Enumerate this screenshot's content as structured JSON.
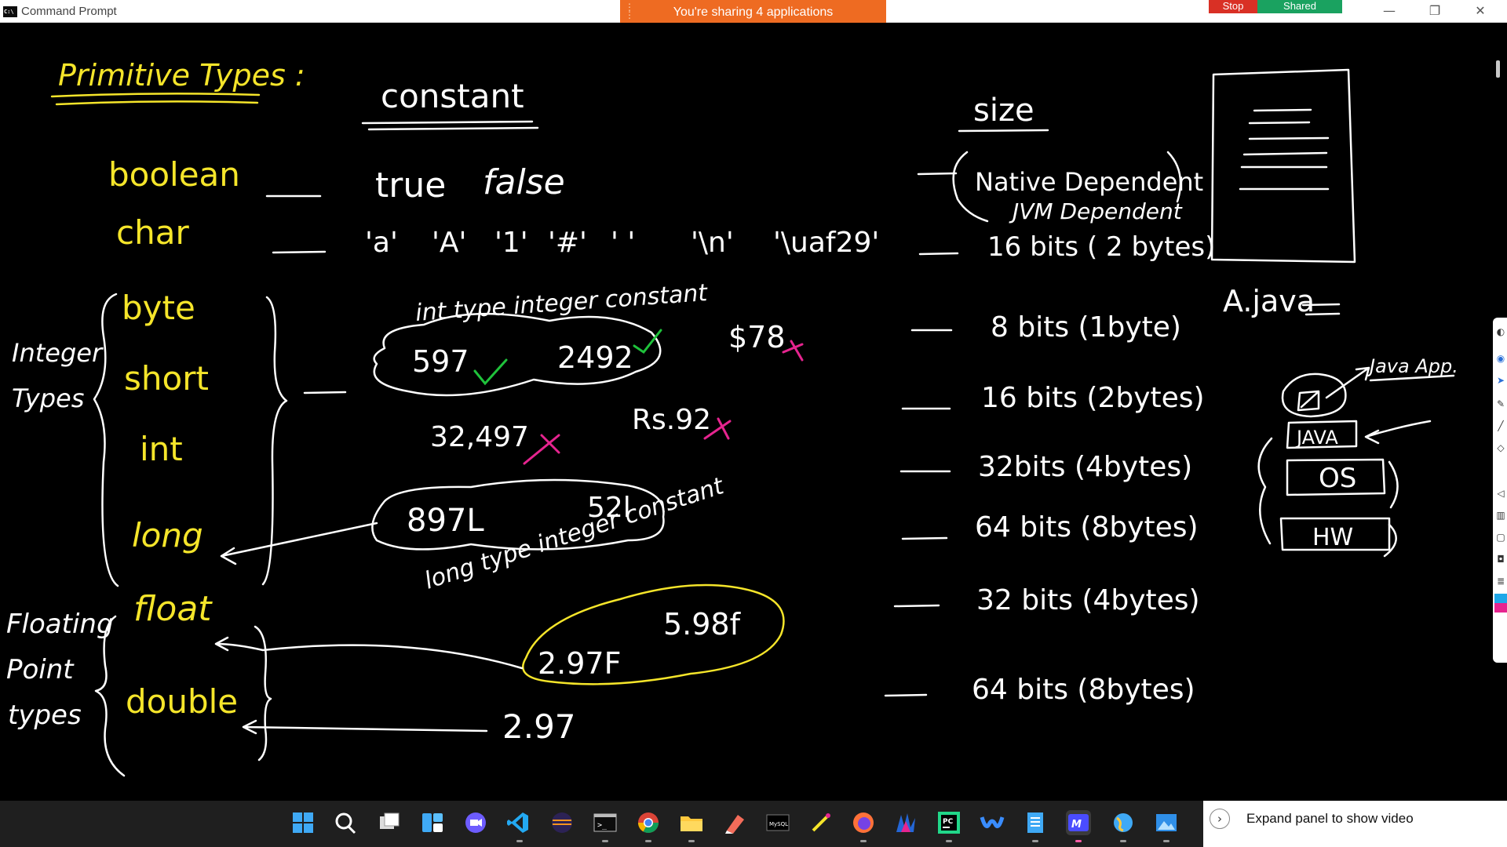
{
  "window": {
    "title": "Command Prompt",
    "icon": "C:\\"
  },
  "share_banner": {
    "text": "You're sharing 4 applications",
    "stop": "Stop",
    "shared": "Shared"
  },
  "window_controls": {
    "minimize": "—",
    "maximize": "❐",
    "close": "✕"
  },
  "board": {
    "title": "Primitive Types :",
    "col_constant": "constant",
    "col_size": "size",
    "rows": {
      "boolean": "boolean",
      "char": "char",
      "byte": "byte",
      "short": "short",
      "int": "int",
      "long": "long",
      "float": "float",
      "double": "double"
    },
    "groups": {
      "integer_1": "Integer",
      "integer_2": "Types",
      "floating_1": "Floating",
      "floating_2": "Point",
      "floating_3": "types"
    },
    "constants": {
      "true": "true",
      "false": "false",
      "char_values": [
        "'a'",
        "'A'",
        "'1'",
        "'#'",
        "' '",
        "'\\n'",
        "'\\uaf29'"
      ],
      "int_caption": "int type integer constant",
      "int_ok_1": "597",
      "int_ok_2": "2492",
      "bad_dollar": "$78",
      "bad_comma": "32,497",
      "bad_rs": "Rs.92",
      "long_1": "897L",
      "long_2": "52l",
      "long_caption": "long type integer constant",
      "float_1": "2.97F",
      "float_2": "5.98f",
      "double_1": "2.97"
    },
    "sizes": {
      "boolean_1": "Native Dependent",
      "boolean_2": "JVM Dependent",
      "char": "16 bits ( 2 bytes)",
      "byte": "8 bits (1byte)",
      "short": "16 bits (2bytes)",
      "int": "32bits (4bytes)",
      "long": "64 bits (8bytes)",
      "float": "32 bits (4bytes)",
      "double": "64 bits (8bytes)"
    },
    "file_label": "A.java",
    "stack": {
      "app": "Java App.",
      "java": "JAVA",
      "os": "OS",
      "hw": "HW"
    }
  },
  "taskbar": {
    "icons": [
      "windows-start-icon",
      "search-icon",
      "task-view-icon",
      "widgets-icon",
      "meet-icon",
      "vscode-icon",
      "eclipse-icon",
      "terminal-icon",
      "chrome-icon",
      "file-explorer-icon",
      "paint-icon",
      "mysql-icon",
      "tool-icon",
      "firefox-icon",
      "game-icon",
      "pycharm-icon",
      "webex-icon",
      "notepad-icon",
      "whiteboard-icon",
      "browser-icon",
      "photos-icon"
    ],
    "expand_panel": "Expand panel to show video"
  },
  "colors": {
    "chalk_yellow": "#f5e52a",
    "chalk_white": "#ffffff",
    "check_green": "#1fc23b",
    "cross_pink": "#e6248f",
    "share_orange": "#ee6b22"
  }
}
